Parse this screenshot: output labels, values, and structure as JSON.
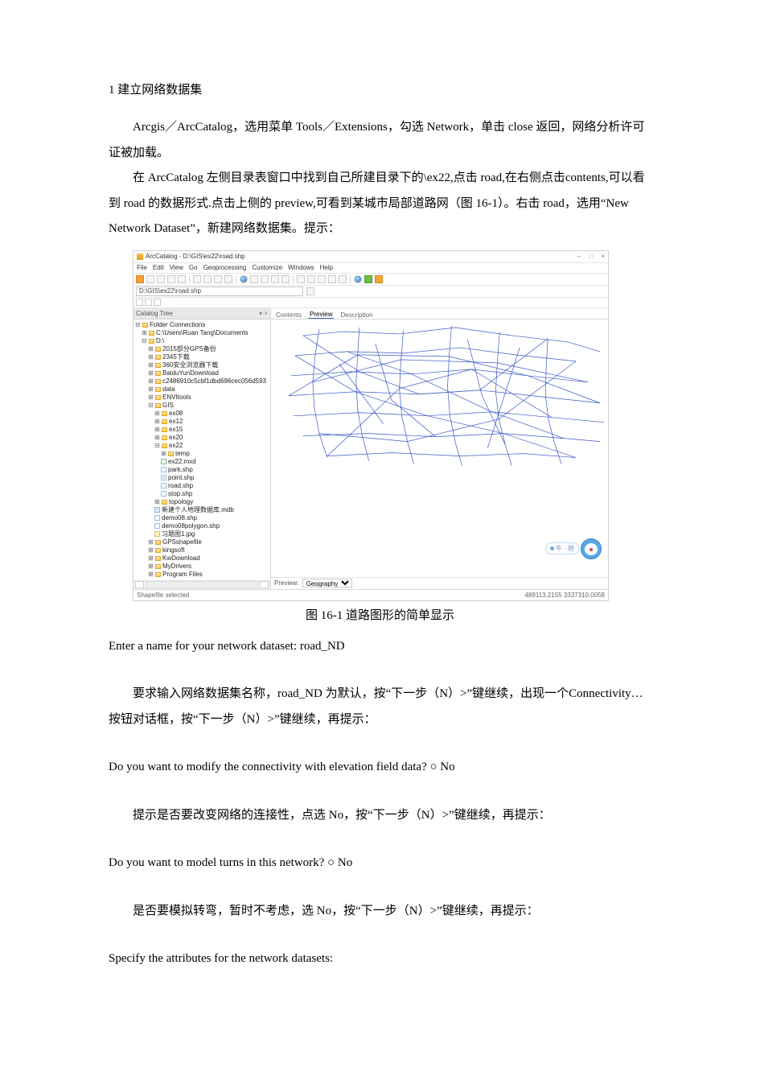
{
  "heading": "1  建立网络数据集",
  "para1": "Arcgis／ArcCatalog，选用菜单 Tools／Extensions，勾选 Network，单击 close 返回，网络分析许可证被加载。",
  "para2a": "在 ArcCatalog 左侧目录表窗口中找到自己所建目录下的\\ex22,点击 road,在右侧点击contents,可以看到 road 的数据形式.点击上侧的 preview,可看到某城市局部道路网（图 16-1）。右击 road，选用“New Network Dataset”，新建网络数据集。提示：",
  "caption": "图 16-1  道路图形的简单显示",
  "prompt1": "Enter a name for your network dataset:  road_ND",
  "para3": "要求输入网络数据集名称，road_ND 为默认，按“下一步（N）>”键继续，出现一个Connectivity…按钮对话框，按“下一步（N）>”键继续，再提示：",
  "prompt2": "Do you want to modify the connectivity with elevation field data?  ○  No",
  "para4": "提示是否要改变网络的连接性，点选 No，按“下一步（N）>”键继续，再提示：",
  "prompt3": "Do you want to model turns in this network?  ○  No",
  "para5": "是否要模拟转弯，暂时不考虑，选 No，按“下一步（N）>”键继续，再提示：",
  "prompt4": "Specify the attributes for the network datasets:",
  "arc": {
    "title": "ArcCatalog - D:\\GIS\\ex22\\road.shp",
    "menu": [
      "File",
      "Edit",
      "View",
      "Go",
      "Geoprocessing",
      "Customize",
      "Windows",
      "Help"
    ],
    "address": "D:\\GIS\\ex22\\road.shp",
    "catalog_header": "Catalog Tree",
    "tree": {
      "root": "Folder Connections",
      "docs": "C:\\Users\\Ruan Tang\\Documents",
      "d": "D:\\",
      "items_d": [
        "2015部分GPS备份",
        "2345下载",
        "360安全浏览器下载",
        "BaiduYunDownload",
        "c2486910c5cbf1dbd696cec056d593",
        "data",
        "ENVItools"
      ],
      "gis": "GIS",
      "ex_folders": [
        "ex08",
        "ex12",
        "ex15",
        "ex20"
      ],
      "ex22": "ex22",
      "ex22_temp": "temp",
      "ex22_items": [
        {
          "label": "ex22.mxd",
          "kind": "rd"
        },
        {
          "label": "park.shp",
          "kind": "shp"
        },
        {
          "label": "point.shp",
          "kind": "pt"
        },
        {
          "label": "road.shp",
          "kind": "shp"
        },
        {
          "label": "stop.shp",
          "kind": "shp"
        }
      ],
      "after_ex22": [
        "topology",
        "新建个人地理数据库.mdb",
        "demo08.shp",
        "demo08polygon.shp",
        "习题图1.jpg"
      ],
      "tail": [
        "GPSshapefile",
        "kingsoft",
        "KwDownload",
        "MyDrivers",
        "Program Files"
      ]
    },
    "tabs": [
      "Contents",
      "Preview",
      "Description"
    ],
    "preview_label": "Preview:",
    "preview_value": "Geography",
    "status": "Shapefile selected",
    "coords": "489113.2155  3337310.0058",
    "badge": "牛 · 陪"
  }
}
